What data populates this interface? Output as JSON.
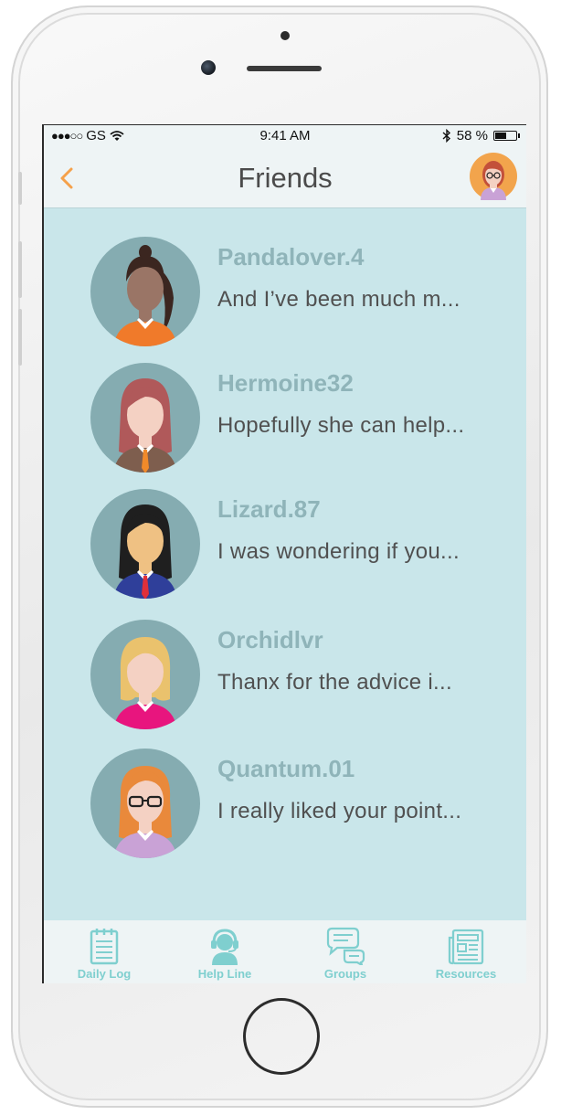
{
  "status_bar": {
    "carrier": "GS",
    "time": "9:41 AM",
    "battery_text": "58 %",
    "battery_level": 0.58
  },
  "nav": {
    "title": "Friends",
    "back_icon": "chevron-left-icon",
    "profile_icon": "user-avatar-icon"
  },
  "friends": [
    {
      "name": "Pandalover.4",
      "message": "And I’ve been much m...",
      "avatar": {
        "skin": "#9a7566",
        "hair": "#3b2620",
        "shirt": "#f07a2a",
        "style": "ponytail"
      }
    },
    {
      "name": "Hermoine32",
      "message": "Hopefully she can help...",
      "avatar": {
        "skin": "#f4d1c3",
        "hair": "#b0595a",
        "shirt": "#7e5e4e",
        "tie": "#f08a2a",
        "style": "long"
      }
    },
    {
      "name": "Lizard.87",
      "message": "I was wondering if you...",
      "avatar": {
        "skin": "#efc183",
        "hair": "#1f1f1f",
        "shirt": "#2f3f9a",
        "tie": "#e0303a",
        "style": "long"
      }
    },
    {
      "name": "Orchidlvr",
      "message": "Thanx for the advice i...",
      "avatar": {
        "skin": "#f4d1c3",
        "hair": "#eac26d",
        "shirt": "#e8157e",
        "style": "bob"
      }
    },
    {
      "name": "Quantum.01",
      "message": "I really liked your point...",
      "avatar": {
        "skin": "#f4d1c3",
        "hair": "#e9893b",
        "shirt": "#c9a2d6",
        "style": "glasses"
      }
    }
  ],
  "tabs": [
    {
      "label": "Daily Log",
      "icon": "notepad-icon"
    },
    {
      "label": "Help Line",
      "icon": "headset-icon"
    },
    {
      "label": "Groups",
      "icon": "chat-bubbles-icon"
    },
    {
      "label": "Resources",
      "icon": "newspaper-icon"
    }
  ],
  "colors": {
    "accent": "#f5a14a",
    "list_background": "#c9e6ea",
    "avatar_circle": "#85acb1",
    "friend_name": "#8fb4b9",
    "tab_icon": "#7fcfcf"
  }
}
